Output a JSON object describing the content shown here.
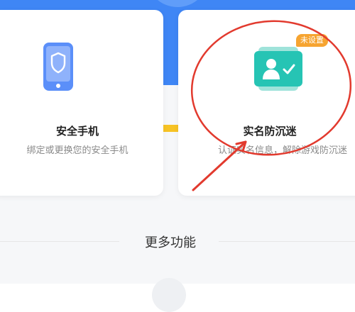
{
  "cards": [
    {
      "title": "安全手机",
      "desc": "绑定或更换您的安全手机",
      "icon": "phone-shield-icon"
    },
    {
      "title": "实名防沉迷",
      "desc": "认证实名信息，解除游戏防沉迷",
      "badge": "未设置",
      "icon": "id-card-check-icon"
    }
  ],
  "more_section": {
    "title": "更多功能"
  },
  "colors": {
    "header_blue": "#3f86f5",
    "phone_icon": "#5b8ff9",
    "id_icon": "#26c4b4",
    "badge": "#f6a431",
    "annotation_red": "#e23a2e"
  }
}
